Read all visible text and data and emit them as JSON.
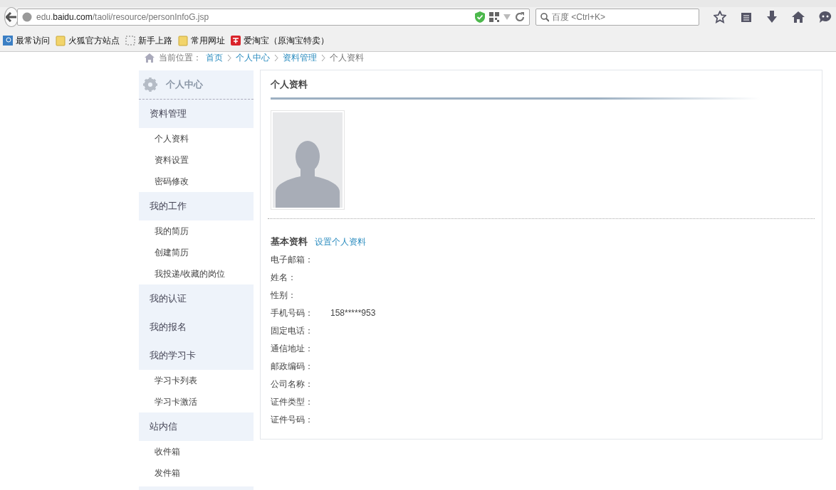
{
  "browser": {
    "url_host_prefix": "edu.",
    "url_host": "baidu.com",
    "url_path": "/taoli/resource/personInfoG.jsp",
    "search_placeholder": "百度 <Ctrl+K>",
    "bookmarks": [
      {
        "kind": "search",
        "label": "最常访问"
      },
      {
        "kind": "folder",
        "label": "火狐官方站点"
      },
      {
        "kind": "dashed",
        "label": "新手上路"
      },
      {
        "kind": "folder",
        "label": "常用网址"
      },
      {
        "kind": "taobao",
        "label": "爱淘宝（原淘宝特卖）"
      }
    ]
  },
  "breadcrumb": {
    "label": "当前位置：",
    "items": [
      {
        "text": "首页",
        "link": true
      },
      {
        "text": "个人中心",
        "link": true
      },
      {
        "text": "资料管理",
        "link": true
      },
      {
        "text": "个人资料",
        "link": false
      }
    ]
  },
  "sidebar": {
    "title": "个人中心",
    "sections": [
      {
        "label": "资料管理",
        "children": [
          {
            "label": "个人资料"
          },
          {
            "label": "资料设置"
          },
          {
            "label": "密码修改"
          }
        ]
      },
      {
        "label": "我的工作",
        "children": [
          {
            "label": "我的简历"
          },
          {
            "label": "创建简历"
          },
          {
            "label": "我投递/收藏的岗位"
          }
        ]
      },
      {
        "label": "我的认证"
      },
      {
        "label": "我的报名"
      },
      {
        "label": "我的学习卡",
        "children": [
          {
            "label": "学习卡列表"
          },
          {
            "label": "学习卡激活"
          }
        ]
      },
      {
        "label": "站内信",
        "children": [
          {
            "label": "收件箱"
          },
          {
            "label": "发件箱"
          }
        ]
      }
    ]
  },
  "panel": {
    "title": "个人资料",
    "section_title": "基本资料",
    "section_link": "设置个人资料",
    "fields": [
      {
        "label": "电子邮箱："
      },
      {
        "label": "姓名："
      },
      {
        "label": "性别："
      },
      {
        "label": "手机号码：",
        "value": "158*****953"
      },
      {
        "label": "固定电话："
      },
      {
        "label": "通信地址："
      },
      {
        "label": "邮政编码："
      },
      {
        "label": "公司名称："
      },
      {
        "label": "证件类型："
      },
      {
        "label": "证件号码："
      }
    ]
  }
}
